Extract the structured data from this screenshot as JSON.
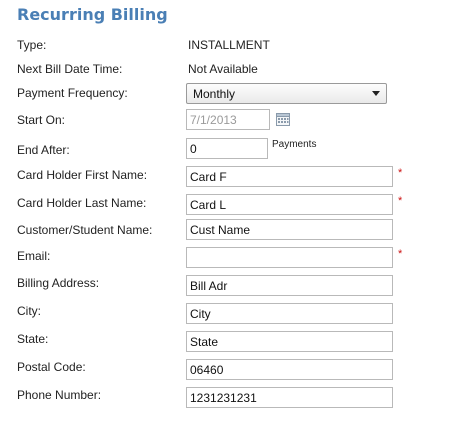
{
  "title": "Recurring Billing",
  "fields": {
    "type": {
      "label": "Type:",
      "value": "INSTALLMENT"
    },
    "next_bill": {
      "label": "Next Bill Date Time:",
      "value": "Not Available"
    },
    "payment_frequency": {
      "label": "Payment Frequency:",
      "value": "Monthly"
    },
    "start_on": {
      "label": "Start On:",
      "value": "7/1/2013"
    },
    "end_after": {
      "label": "End After:",
      "value": "0",
      "unit": "Payments"
    },
    "first_name": {
      "label": "Card Holder First Name:",
      "value": "Card F"
    },
    "last_name": {
      "label": "Card Holder Last Name:",
      "value": "Card L"
    },
    "customer_name": {
      "label": "Customer/Student Name:",
      "value": "Cust Name"
    },
    "email": {
      "label": "Email:",
      "value": ""
    },
    "billing_address": {
      "label": "Billing Address:",
      "value": "Bill Adr"
    },
    "city": {
      "label": "City:",
      "value": "City"
    },
    "state": {
      "label": "State:",
      "value": "State"
    },
    "postal_code": {
      "label": "Postal Code:",
      "value": "06460"
    },
    "phone": {
      "label": "Phone Number:",
      "value": "1231231231"
    }
  },
  "required_marker": "*",
  "icons": {
    "calendar": "calendar-icon",
    "dropdown": "chevron-down-icon"
  },
  "colors": {
    "title": "#4a7fb5",
    "required": "#cc1111"
  }
}
